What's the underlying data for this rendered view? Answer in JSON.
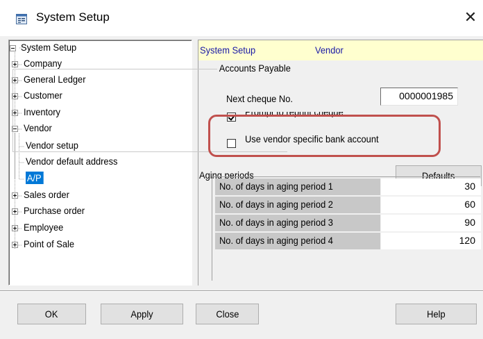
{
  "window": {
    "title": "System Setup",
    "icon": "app-icon",
    "close_glyph": "✕"
  },
  "tree": {
    "nodes": [
      {
        "label": "System Setup",
        "expander": "minus",
        "level": 0
      },
      {
        "label": "Company",
        "expander": "plus",
        "level": 1
      },
      {
        "label": "General Ledger",
        "expander": "plus",
        "level": 1
      },
      {
        "label": "Customer",
        "expander": "plus",
        "level": 1
      },
      {
        "label": "Inventory",
        "expander": "plus",
        "level": 1
      },
      {
        "label": "Vendor",
        "expander": "minus",
        "level": 1
      },
      {
        "label": "Vendor setup",
        "expander": "",
        "level": 2
      },
      {
        "label": "Vendor default address",
        "expander": "",
        "level": 2
      },
      {
        "label": "A/P",
        "expander": "",
        "level": 2,
        "selected": true
      },
      {
        "label": "Sales order",
        "expander": "plus",
        "level": 1
      },
      {
        "label": "Purchase order",
        "expander": "plus",
        "level": 1
      },
      {
        "label": "Employee",
        "expander": "plus",
        "level": 1
      },
      {
        "label": "Point of Sale",
        "expander": "plus",
        "level": 1
      }
    ]
  },
  "header": {
    "section": "System Setup",
    "page": "Vendor"
  },
  "accounts_payable": {
    "legend": "Accounts Payable",
    "next_cheque_label": "Next cheque No.",
    "next_cheque_value": "0000001985",
    "prompt_reprint_label": "Prompt to reprint cheque",
    "prompt_reprint_checked": true,
    "vendor_bank_label": "Use vendor specific bank account",
    "vendor_bank_checked": false
  },
  "aging": {
    "label": "Aging periods",
    "defaults_button": "Defaults",
    "rows": [
      {
        "label": "No. of days in aging period 1",
        "value": "30"
      },
      {
        "label": "No. of days in aging period 2",
        "value": "60"
      },
      {
        "label": "No. of days in aging period 3",
        "value": "90"
      },
      {
        "label": "No. of days in aging period 4",
        "value": "120"
      }
    ]
  },
  "buttons": {
    "ok": "OK",
    "apply": "Apply",
    "close": "Close",
    "help": "Help"
  },
  "colors": {
    "highlight_border": "#c0504d",
    "header_bg": "#ffffcf",
    "header_text": "#1a1aa6",
    "selection": "#0078d7"
  }
}
